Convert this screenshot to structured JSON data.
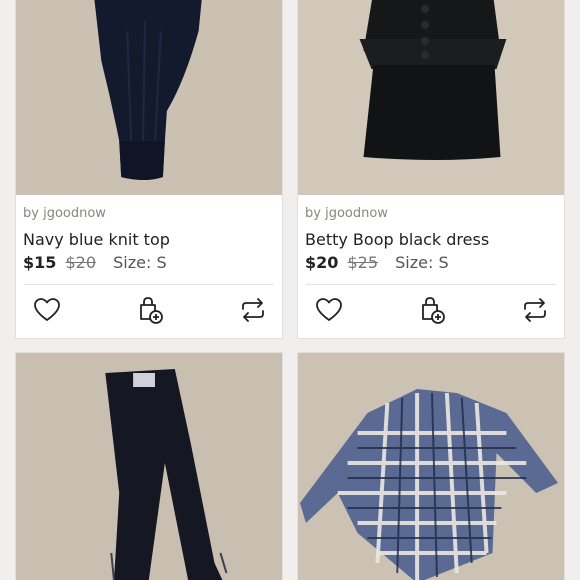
{
  "listings": [
    {
      "seller": "by jgoodnow",
      "title": "Navy blue knit top",
      "price": "$15",
      "original_price": "$20",
      "size": "Size: S",
      "image": "navy-knit-top-photo"
    },
    {
      "seller": "by jgoodnow",
      "title": "Betty Boop black dress",
      "price": "$20",
      "original_price": "$25",
      "size": "Size: S",
      "image": "black-dress-photo"
    },
    {
      "image": "navy-pants-photo"
    },
    {
      "image": "plaid-shirt-photo"
    }
  ],
  "actions": {
    "like_icon": "heart-icon",
    "bundle_icon": "bag-plus-icon",
    "share_icon": "share-arrows-icon"
  },
  "colors": {
    "background": "#f1efee",
    "card": "#ffffff",
    "text": "#222222",
    "muted": "#8a8583",
    "carpet": "#cfc5b6"
  }
}
